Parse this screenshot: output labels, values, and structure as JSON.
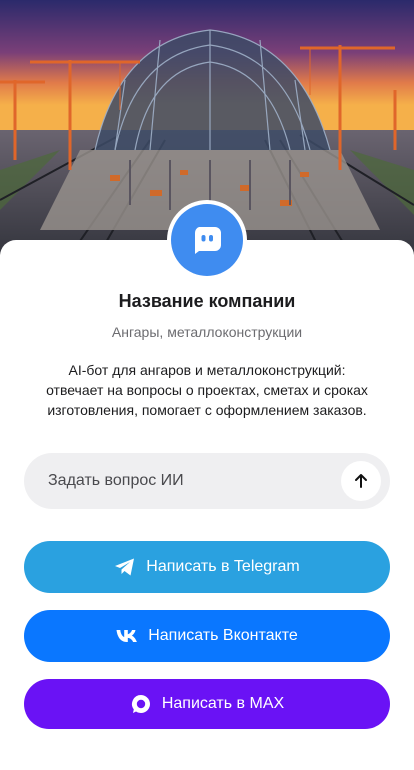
{
  "company": {
    "name": "Название компании",
    "subtitle": "Ангары, металлоконструкции",
    "description": "AI-бот для ангаров и металлоконструкций: отвечает на вопросы о проектах, сметах и сроках изготовления, помогает с оформлением заказов."
  },
  "ask": {
    "placeholder": "Задать вопрос ИИ",
    "send_icon": "arrow-up-icon"
  },
  "buttons": {
    "telegram": {
      "label": "Написать в Telegram",
      "icon": "telegram-icon",
      "color": "#2aa1e0"
    },
    "vk": {
      "label": "Написать Вконтакте",
      "icon": "vk-icon",
      "color": "#0a77ff"
    },
    "max": {
      "label": "Написать в MAX",
      "icon": "max-icon",
      "color": "#6a12f5"
    }
  },
  "colors": {
    "avatar_bg": "#3f8cf0",
    "input_bg": "#efeff1"
  }
}
